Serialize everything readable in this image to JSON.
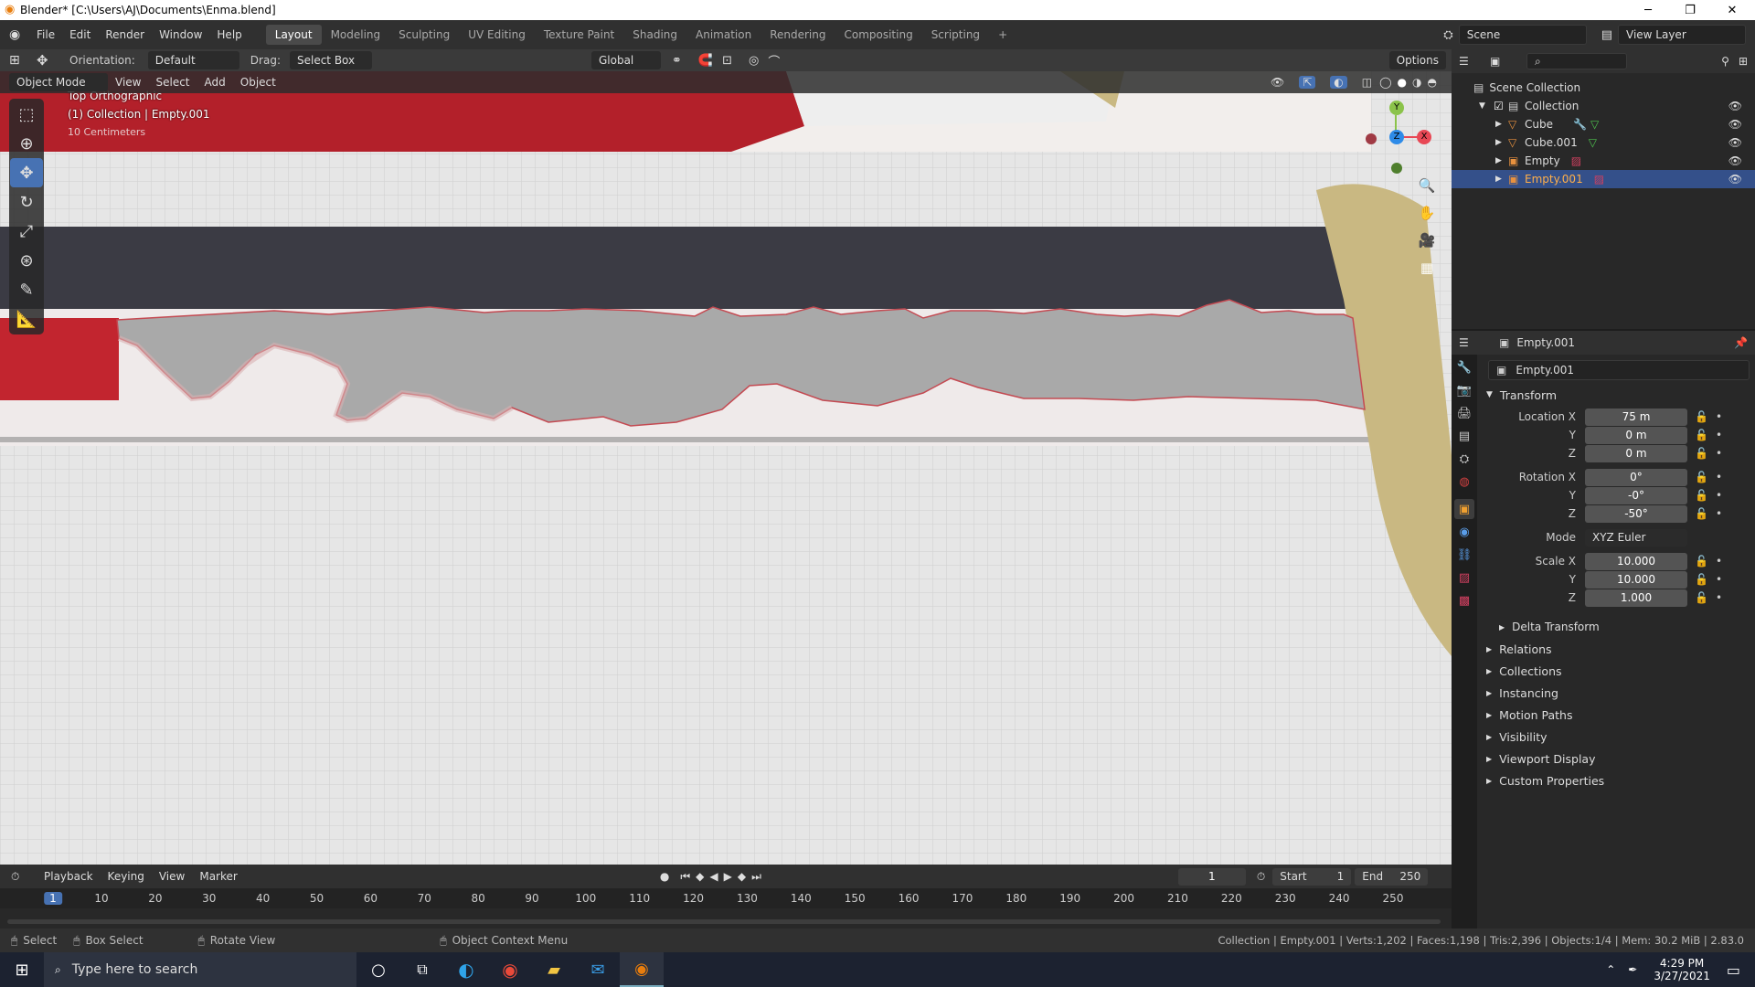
{
  "window": {
    "title": "Blender* [C:\\Users\\AJ\\Documents\\Enma.blend]"
  },
  "menus": [
    "File",
    "Edit",
    "Render",
    "Window",
    "Help"
  ],
  "workspaces": [
    "Layout",
    "Modeling",
    "Sculpting",
    "UV Editing",
    "Texture Paint",
    "Shading",
    "Animation",
    "Rendering",
    "Compositing",
    "Scripting"
  ],
  "topbar": {
    "scene": "Scene",
    "view_layer": "View Layer",
    "add_workspace": "+"
  },
  "header": {
    "orientation_label": "Orientation:",
    "orientation_value": "Default",
    "drag_label": "Drag:",
    "drag_value": "Select Box",
    "transform_orientation": "Global",
    "options": "Options"
  },
  "viewport_header": {
    "mode": "Object Mode",
    "menus": [
      "View",
      "Select",
      "Add",
      "Object"
    ]
  },
  "viewport": {
    "view_name": "Top Orthographic",
    "collection_info": "(1) Collection | Empty.001",
    "scale_info": "10 Centimeters"
  },
  "gizmo": {
    "y": "Y",
    "z": "Z",
    "x": "X"
  },
  "outliner": {
    "root": "Scene Collection",
    "collection": "Collection",
    "items": [
      "Cube",
      "Cube.001",
      "Empty",
      "Empty.001"
    ]
  },
  "properties": {
    "object_name": "Empty.001",
    "datablock": "Empty.001",
    "transform_label": "Transform",
    "location_label": "Location X",
    "rotation_label": "Rotation X",
    "scale_label": "Scale X",
    "axis_y": "Y",
    "axis_z": "Z",
    "location": [
      "75 m",
      "0 m",
      "0 m"
    ],
    "rotation": [
      "0°",
      "-0°",
      "-50°"
    ],
    "mode_label": "Mode",
    "mode_value": "XYZ Euler",
    "scale": [
      "10.000",
      "10.000",
      "1.000"
    ],
    "delta_transform": "Delta Transform",
    "panels": [
      "Relations",
      "Collections",
      "Instancing",
      "Motion Paths",
      "Visibility",
      "Viewport Display",
      "Custom Properties"
    ]
  },
  "timeline": {
    "menus": [
      "Playback",
      "Keying",
      "View",
      "Marker"
    ],
    "current_frame": "1",
    "start_label": "Start",
    "start": "1",
    "end_label": "End",
    "end": "250",
    "ticks": [
      "1",
      "10",
      "20",
      "30",
      "40",
      "50",
      "60",
      "70",
      "80",
      "90",
      "100",
      "110",
      "120",
      "130",
      "140",
      "150",
      "160",
      "170",
      "180",
      "190",
      "200",
      "210",
      "220",
      "230",
      "240",
      "250"
    ]
  },
  "statusbar": {
    "select": "Select",
    "box_select": "Box Select",
    "rotate_view": "Rotate View",
    "context_menu": "Object Context Menu",
    "stats": "Collection | Empty.001 | Verts:1,202 | Faces:1,198 | Tris:2,396 | Objects:1/4 | Mem: 30.2 MiB | 2.83.0"
  },
  "taskbar": {
    "search_placeholder": "Type here to search",
    "time": "4:29 PM",
    "date": "3/27/2021"
  },
  "colors": {
    "accent": "#4772b3",
    "selected_row": "#34508a",
    "viewport_bg": "#e4e4e4",
    "red": "#b3202a"
  }
}
